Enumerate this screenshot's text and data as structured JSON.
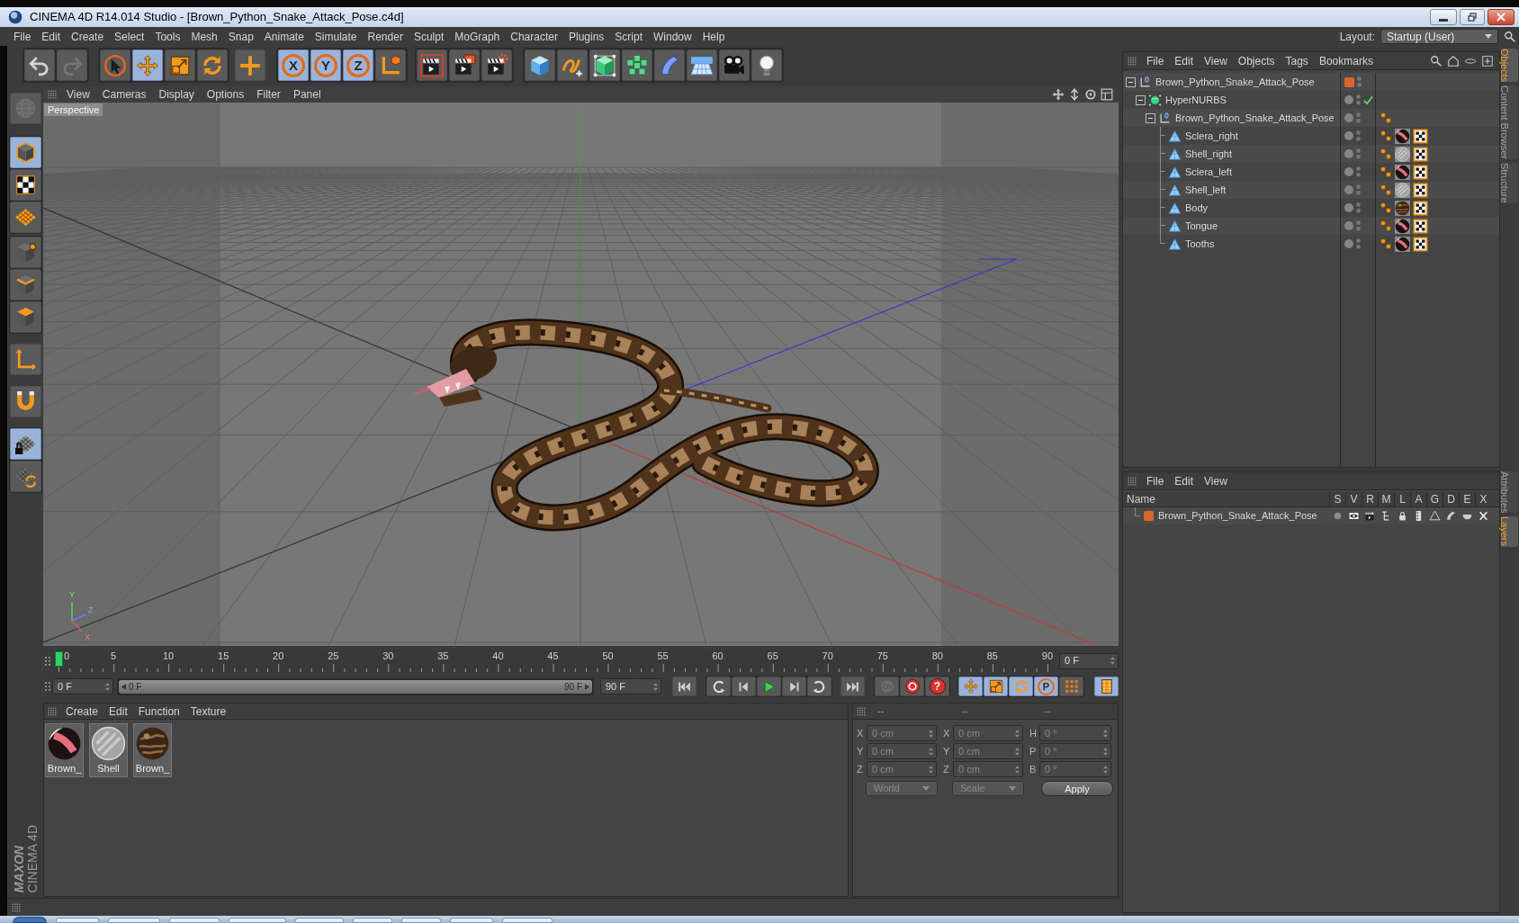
{
  "window": {
    "title": "CINEMA 4D R14.014 Studio - [Brown_Python_Snake_Attack_Pose.c4d]"
  },
  "menu_bar": [
    "File",
    "Edit",
    "Create",
    "Select",
    "Tools",
    "Mesh",
    "Snap",
    "Animate",
    "Simulate",
    "Render",
    "Sculpt",
    "MoGraph",
    "Character",
    "Plugins",
    "Script",
    "Window",
    "Help"
  ],
  "layout": {
    "label": "Layout:",
    "value": "Startup (User)"
  },
  "toolbar": [
    [
      {
        "kind": "undo",
        "selected": false,
        "disabled": false
      },
      {
        "kind": "redo",
        "selected": false,
        "disabled": true
      }
    ],
    [
      {
        "kind": "live-select",
        "selected": false,
        "disabled": false
      },
      {
        "kind": "move",
        "selected": true,
        "disabled": false
      },
      {
        "kind": "scale",
        "selected": false,
        "disabled": false
      },
      {
        "kind": "rotate",
        "selected": false,
        "disabled": false
      }
    ],
    [
      {
        "kind": "add",
        "selected": false,
        "disabled": false
      }
    ],
    [
      {
        "kind": "axis",
        "label": "X",
        "selected": true,
        "disabled": false
      },
      {
        "kind": "axis",
        "label": "Y",
        "selected": true,
        "disabled": false
      },
      {
        "kind": "axis",
        "label": "Z",
        "selected": true,
        "disabled": false
      },
      {
        "kind": "coordinates",
        "selected": false,
        "disabled": false
      }
    ],
    [
      {
        "kind": "render-view",
        "selected": false,
        "disabled": false
      },
      {
        "kind": "render-picture",
        "selected": false,
        "disabled": false
      },
      {
        "kind": "render-settings",
        "selected": false,
        "disabled": false
      }
    ],
    [
      {
        "kind": "cube",
        "selected": false,
        "disabled": false
      },
      {
        "kind": "spline",
        "selected": false,
        "disabled": false
      },
      {
        "kind": "nurbs",
        "selected": false,
        "disabled": false
      },
      {
        "kind": "cloner",
        "selected": false,
        "disabled": false
      },
      {
        "kind": "deformer",
        "selected": false,
        "disabled": false
      },
      {
        "kind": "floor",
        "selected": false,
        "disabled": false
      },
      {
        "kind": "camera",
        "selected": false,
        "disabled": false
      },
      {
        "kind": "light",
        "selected": false,
        "disabled": false
      }
    ]
  ],
  "mode_tools": [
    [
      {
        "kind": "make-editable",
        "selected": false,
        "disabled": true
      }
    ],
    [
      {
        "kind": "model",
        "selected": true,
        "disabled": false
      },
      {
        "kind": "texture",
        "selected": false,
        "disabled": false
      },
      {
        "kind": "workplane",
        "selected": false,
        "disabled": false
      }
    ],
    [
      {
        "kind": "points",
        "selected": false,
        "disabled": false
      },
      {
        "kind": "edges",
        "selected": false,
        "disabled": false
      },
      {
        "kind": "polygons",
        "selected": false,
        "disabled": false
      }
    ],
    [
      {
        "kind": "axis-mode",
        "selected": false,
        "disabled": false
      }
    ],
    [
      {
        "kind": "snap",
        "selected": false,
        "disabled": false
      }
    ],
    [
      {
        "kind": "locked-workplane",
        "selected": true,
        "disabled": false
      },
      {
        "kind": "planar-workplane",
        "selected": false,
        "disabled": false
      }
    ]
  ],
  "logo": {
    "brand": "MAXON",
    "product": "CINEMA 4D"
  },
  "viewport": {
    "menu": [
      "View",
      "Cameras",
      "Display",
      "Options",
      "Filter",
      "Panel"
    ],
    "camera": "Perspective",
    "gizmo_labels": [
      "Y",
      "Z",
      "X"
    ]
  },
  "timeline": {
    "ticks": [
      "0",
      "5",
      "10",
      "15",
      "20",
      "25",
      "30",
      "35",
      "40",
      "45",
      "50",
      "55",
      "60",
      "65",
      "70",
      "75",
      "80",
      "85",
      "90"
    ],
    "playhead": {
      "level": 0
    },
    "current_frame": "0 F"
  },
  "playback": {
    "start": "0 F",
    "range": {
      "start": "0 F",
      "end": "90 F",
      "level": 1
    },
    "end": "90 F",
    "transport": [
      [
        {
          "kind": "first"
        }
      ],
      [
        {
          "kind": "prev-key"
        },
        {
          "kind": "prev-frame"
        },
        {
          "kind": "play"
        },
        {
          "kind": "next-frame"
        },
        {
          "kind": "next-key"
        }
      ],
      [
        {
          "kind": "last"
        }
      ]
    ],
    "record": [
      {
        "kind": "key-selection",
        "disabled": true
      },
      {
        "kind": "record",
        "disabled": false
      },
      {
        "kind": "autokey",
        "label": "?",
        "disabled": false
      }
    ],
    "keys": [
      {
        "kind": "position",
        "selected": true
      },
      {
        "kind": "scale",
        "selected": true
      },
      {
        "kind": "rotation",
        "selected": true
      },
      {
        "kind": "parameter",
        "label": "P",
        "selected": true
      },
      {
        "kind": "point-level",
        "selected": false
      }
    ],
    "scheme": {
      "selected": true
    }
  },
  "materials": {
    "menu": [
      "Create",
      "Edit",
      "Function",
      "Texture"
    ],
    "items": [
      {
        "name": "Brown_",
        "kind": "eye"
      },
      {
        "name": "Shell",
        "kind": "glass"
      },
      {
        "name": "Brown_",
        "kind": "skin"
      }
    ]
  },
  "coordinates": {
    "headers": [
      "--",
      "--",
      "--"
    ],
    "rows": [
      [
        {
          "axis": "X",
          "value": "0 cm"
        },
        {
          "axis": "X",
          "value": "0 cm"
        },
        {
          "axis": "H",
          "value": "0 °"
        }
      ],
      [
        {
          "axis": "Y",
          "value": "0 cm"
        },
        {
          "axis": "Y",
          "value": "0 cm"
        },
        {
          "axis": "P",
          "value": "0 °"
        }
      ],
      [
        {
          "axis": "Z",
          "value": "0 cm"
        },
        {
          "axis": "Z",
          "value": "0 cm"
        },
        {
          "axis": "B",
          "value": "0 °"
        }
      ]
    ],
    "disabled": true,
    "dropdowns": [
      "World",
      "Scale"
    ],
    "apply": "Apply"
  },
  "objects": {
    "menu": [
      "File",
      "Edit",
      "View",
      "Objects",
      "Tags",
      "Bookmarks"
    ],
    "tree": [
      {
        "name": "Brown_Python_Snake_Attack_Pose",
        "kind": "null",
        "expanded": true,
        "color": "#d9652b",
        "children": [
          {
            "name": "HyperNURBS",
            "kind": "nurbs",
            "expanded": true,
            "enabled": true,
            "children": [
              {
                "name": "Brown_Python_Snake_Attack_Pose",
                "kind": "null",
                "expanded": true,
                "tags": [
                  {
                    "kind": "phong"
                  }
                ],
                "children": [
                  {
                    "name": "Sclera_right",
                    "kind": "polygon",
                    "tags": [
                      {
                        "kind": "phong"
                      },
                      {
                        "kind": "material-eye"
                      },
                      {
                        "kind": "uvw"
                      }
                    ]
                  },
                  {
                    "name": "Shell_right",
                    "kind": "polygon",
                    "tags": [
                      {
                        "kind": "phong"
                      },
                      {
                        "kind": "material-glass"
                      },
                      {
                        "kind": "uvw"
                      }
                    ]
                  },
                  {
                    "name": "Sclera_left",
                    "kind": "polygon",
                    "tags": [
                      {
                        "kind": "phong"
                      },
                      {
                        "kind": "material-eye"
                      },
                      {
                        "kind": "uvw"
                      }
                    ]
                  },
                  {
                    "name": "Shell_left",
                    "kind": "polygon",
                    "tags": [
                      {
                        "kind": "phong"
                      },
                      {
                        "kind": "material-glass"
                      },
                      {
                        "kind": "uvw"
                      }
                    ]
                  },
                  {
                    "name": "Body",
                    "kind": "polygon",
                    "tags": [
                      {
                        "kind": "phong"
                      },
                      {
                        "kind": "material-skin"
                      },
                      {
                        "kind": "uvw"
                      }
                    ]
                  },
                  {
                    "name": "Tongue",
                    "kind": "polygon",
                    "tags": [
                      {
                        "kind": "phong"
                      },
                      {
                        "kind": "material-eye"
                      },
                      {
                        "kind": "uvw"
                      }
                    ]
                  },
                  {
                    "name": "Tooths",
                    "kind": "polygon",
                    "tags": [
                      {
                        "kind": "phong"
                      },
                      {
                        "kind": "material-eye"
                      },
                      {
                        "kind": "uvw"
                      }
                    ]
                  }
                ]
              }
            ]
          }
        ]
      }
    ]
  },
  "layers": {
    "menu": [
      "File",
      "Edit",
      "View"
    ],
    "columns": [
      "Name",
      "S",
      "V",
      "R",
      "M",
      "L",
      "A",
      "G",
      "D",
      "E",
      "X"
    ],
    "rows": [
      {
        "name": "Brown_Python_Snake_Attack_Pose",
        "color": "#d9652b"
      }
    ]
  },
  "side_tabs": {
    "top": [
      {
        "label": "Objects",
        "selected": true
      },
      {
        "label": "Content Browser",
        "selected": false
      },
      {
        "label": "Structure",
        "selected": false
      }
    ],
    "bottom": [
      {
        "label": "Attributes",
        "selected": false
      },
      {
        "label": "Layers",
        "selected": true
      }
    ]
  }
}
